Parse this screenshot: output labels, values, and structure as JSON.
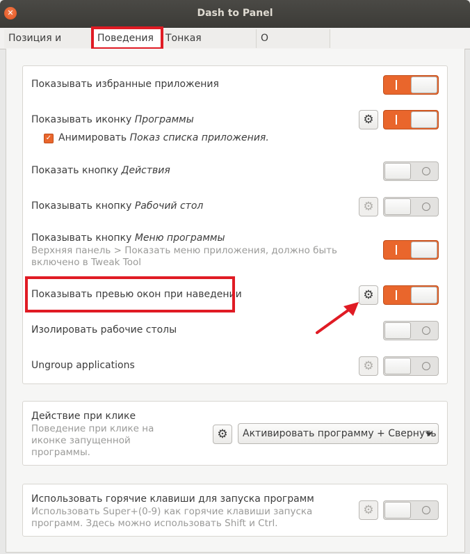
{
  "window": {
    "title": "Dash to Panel",
    "close_glyph": "✕"
  },
  "tabs": [
    {
      "label": "Позиция и стиль"
    },
    {
      "label": "Поведения"
    },
    {
      "label": "Тонкая настройка"
    },
    {
      "label": "О программе"
    }
  ],
  "rows": {
    "fav": {
      "label": "Показывать избранные приложения",
      "state": "on"
    },
    "apps": {
      "label": "Показывать иконку ",
      "label_italic": "Программы",
      "state": "on"
    },
    "animate": {
      "label": "Анимировать ",
      "label_italic": "Показ списка приложения.",
      "checked": true
    },
    "actions": {
      "label": "Показать кнопку ",
      "label_italic": "Действия",
      "state": "off"
    },
    "desktop": {
      "label": "Показывать кнопку ",
      "label_italic": "Рабочий стол",
      "state": "off"
    },
    "appmenu": {
      "label": "Показывать кнопку ",
      "label_italic": "Меню программы",
      "sub1": "Верхняя панель > Показать меню приложения, должно быть",
      "sub2": "включено в Tweak Tool",
      "state": "on"
    },
    "preview": {
      "label": "Показывать превью окон при наведении",
      "state": "on"
    },
    "isolate": {
      "label": "Изолировать рабочие столы",
      "state": "off"
    },
    "ungroup": {
      "label": "Ungroup applications",
      "state": "off"
    }
  },
  "click_action": {
    "label": "Действие при клике",
    "sub1": "Поведение при клике на",
    "sub2": "иконке запущенной",
    "sub3": "программы.",
    "selected": "Активировать программу + Свернуть"
  },
  "hotkeys": {
    "label": "Использовать горячие клавиши для запуска программ",
    "sub1": "Использовать Super+(0-9) как горячие клавиши запуска",
    "sub2": "программ. Здесь можно использовать Shift и Ctrl.",
    "state": "off"
  },
  "icons": {
    "gear": "⚙",
    "check": "✓"
  },
  "colors": {
    "accent": "#e9662c",
    "highlight": "#e01b24"
  }
}
